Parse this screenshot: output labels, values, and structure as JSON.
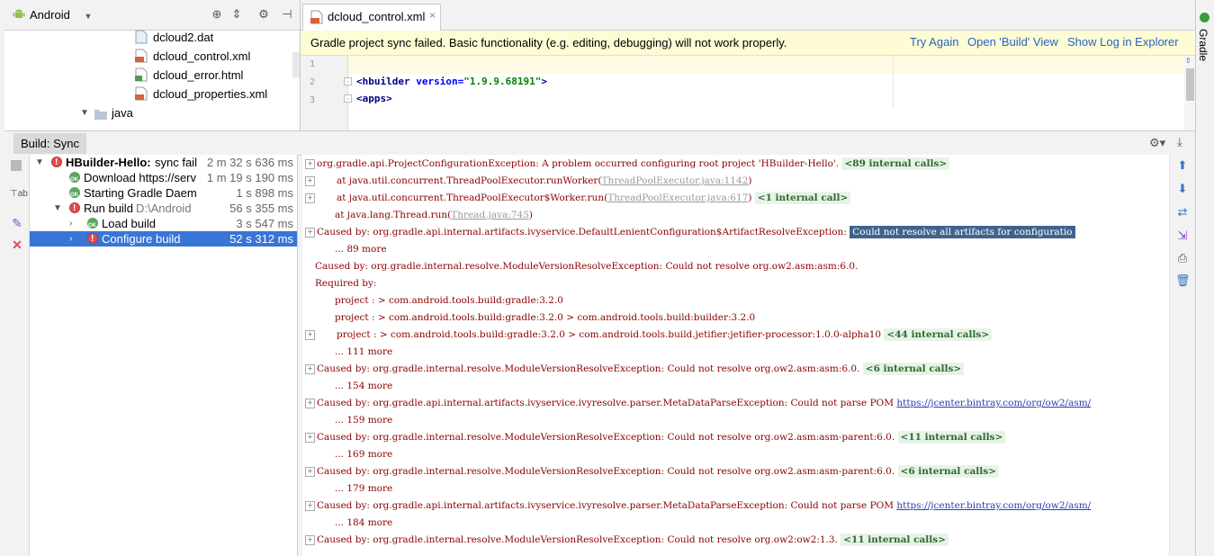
{
  "project": {
    "view": "Android",
    "files": [
      {
        "name": "dcloud2.dat",
        "icon": "dat-file-icon"
      },
      {
        "name": "dcloud_control.xml",
        "icon": "xml-file-icon"
      },
      {
        "name": "dcloud_error.html",
        "icon": "html-file-icon"
      },
      {
        "name": "dcloud_properties.xml",
        "icon": "xml-file-icon"
      }
    ],
    "folder": "java"
  },
  "editor": {
    "tab_label": "dcloud_control.xml",
    "banner": {
      "message": "Gradle project sync failed. Basic functionality (e.g. editing, debugging) will not work properly.",
      "try_again": "Try Again",
      "open_build": "Open 'Build' View",
      "show_log": "Show Log in Explorer"
    },
    "lines": [
      {
        "num": "1",
        "text": ""
      },
      {
        "num": "2",
        "tag": "hbuilder",
        "attr": "version",
        "value": "\"1.9.9.68191\""
      },
      {
        "num": "3",
        "tag": "apps"
      }
    ]
  },
  "gradle_strip": {
    "label": "Gradle"
  },
  "build": {
    "tab_label": "Build: Sync",
    "tree": [
      {
        "label": "HBuilder-Hello:",
        "extra": " sync fail",
        "time": "2 m 32 s 636 ms",
        "status": "error",
        "bold": true
      },
      {
        "label": "Download https://serv",
        "time": "1 m 19 s 190 ms",
        "status": "ok"
      },
      {
        "label": "Starting Gradle Daem",
        "time": "1 s 898 ms",
        "status": "ok"
      },
      {
        "label": "Run build",
        "extra": "  D:\\Android",
        "time": "56 s 355 ms",
        "status": "error"
      },
      {
        "label": "Load build",
        "time": "3 s 547 ms",
        "status": "ok"
      },
      {
        "label": "Configure build",
        "time": "52 s 312 ms",
        "status": "error",
        "selected": true
      }
    ],
    "console": [
      {
        "fold": true,
        "text": "org.gradle.api.ProjectConfigurationException: A problem occurred configuring root project 'HBuilder-Hello'.",
        "badge": "<89 internal calls>"
      },
      {
        "fold": true,
        "indent": true,
        "text": "at java.util.concurrent.ThreadPoolExecutor.runWorker(",
        "link": "ThreadPoolExecutor.java:1142",
        "tail": ")"
      },
      {
        "fold": true,
        "indent": true,
        "text": "at java.util.concurrent.ThreadPoolExecutor$Worker.run(",
        "link": "ThreadPoolExecutor.java:617",
        "tail": ")",
        "badge": "<1 internal call>"
      },
      {
        "indent": true,
        "text": "at java.lang.Thread.run(",
        "link": "Thread.java:745",
        "tail": ")"
      },
      {
        "fold": true,
        "text": "Caused by: org.gradle.api.internal.artifacts.ivyservice.DefaultLenientConfiguration$ArtifactResolveException:",
        "highlight": "Could not resolve all artifacts for configuratio"
      },
      {
        "indent": true,
        "text": "... 89 more"
      },
      {
        "text": "Caused by: org.gradle.internal.resolve.ModuleVersionResolveException: Could not resolve org.ow2.asm:asm:6.0."
      },
      {
        "text": "Required by:"
      },
      {
        "indent": true,
        "text": "project : > com.android.tools.build:gradle:3.2.0"
      },
      {
        "indent": true,
        "text": "project : > com.android.tools.build:gradle:3.2.0 > com.android.tools.build:builder:3.2.0"
      },
      {
        "fold": true,
        "indent": true,
        "text": "project : > com.android.tools.build:gradle:3.2.0 > com.android.tools.build.jetifier:jetifier-processor:1.0.0-alpha10",
        "badge": "<44 internal calls>"
      },
      {
        "indent": true,
        "text": "... 111 more"
      },
      {
        "fold": true,
        "text": "Caused by: org.gradle.internal.resolve.ModuleVersionResolveException: Could not resolve org.ow2.asm:asm:6.0.",
        "badge": "<6 internal calls>"
      },
      {
        "indent": true,
        "text": "... 154 more"
      },
      {
        "fold": true,
        "text": "Caused by: org.gradle.api.internal.artifacts.ivyservice.ivyresolve.parser.MetaDataParseException: Could not parse POM",
        "url": "https://jcenter.bintray.com/org/ow2/asm/"
      },
      {
        "indent": true,
        "text": "... 159 more"
      },
      {
        "fold": true,
        "text": "Caused by: org.gradle.internal.resolve.ModuleVersionResolveException: Could not resolve org.ow2.asm:asm-parent:6.0.",
        "badge": "<11 internal calls>"
      },
      {
        "indent": true,
        "text": "... 169 more"
      },
      {
        "fold": true,
        "text": "Caused by: org.gradle.internal.resolve.ModuleVersionResolveException: Could not resolve org.ow2.asm:asm-parent:6.0.",
        "badge": "<6 internal calls>"
      },
      {
        "indent": true,
        "text": "... 179 more"
      },
      {
        "fold": true,
        "text": "Caused by: org.gradle.api.internal.artifacts.ivyservice.ivyresolve.parser.MetaDataParseException: Could not parse POM",
        "url": "https://jcenter.bintray.com/org/ow2/asm/"
      },
      {
        "indent": true,
        "text": "... 184 more"
      },
      {
        "fold": true,
        "text": "Caused by: org.gradle.internal.resolve.ModuleVersionResolveException: Could not resolve org.ow2:ow2:1.3.",
        "badge": "<11 internal calls>"
      }
    ]
  }
}
